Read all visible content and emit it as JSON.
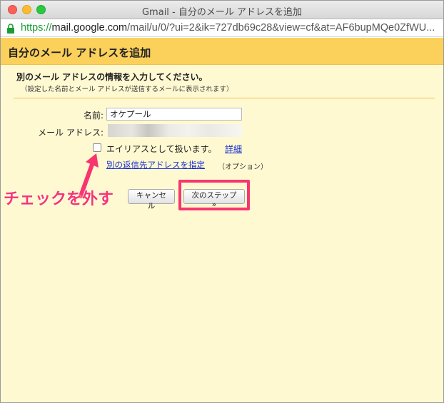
{
  "window": {
    "title": "Gmail - 自分のメール アドレスを追加"
  },
  "address_bar": {
    "protocol": "https://",
    "host": "mail.google.com",
    "path": "/mail/u/0/?ui=2&ik=727db69c28&view=cf&at=AF6bupMQe0ZfWU..."
  },
  "dialog": {
    "heading": "自分のメール アドレスを追加",
    "intro": "別のメール アドレスの情報を入力してください。",
    "intro_sub": "（設定した名前とメール アドレスが送信するメールに表示されます）",
    "name_label": "名前:",
    "name_value": "オケプール",
    "email_label": "メール アドレス:",
    "alias_label": "エイリアスとして扱います。",
    "detail_link": "詳細",
    "reply_to_link": "別の返信先アドレスを指定",
    "option_note": "（オプション）",
    "cancel_label": "キャンセル",
    "next_label": "次のステップ »"
  },
  "annotation": {
    "text": "チェックを外す",
    "color": "#f7356f"
  },
  "colors": {
    "heading_bg": "#fbd05b",
    "content_bg": "#fff9d2",
    "link": "#1a2fd0"
  }
}
